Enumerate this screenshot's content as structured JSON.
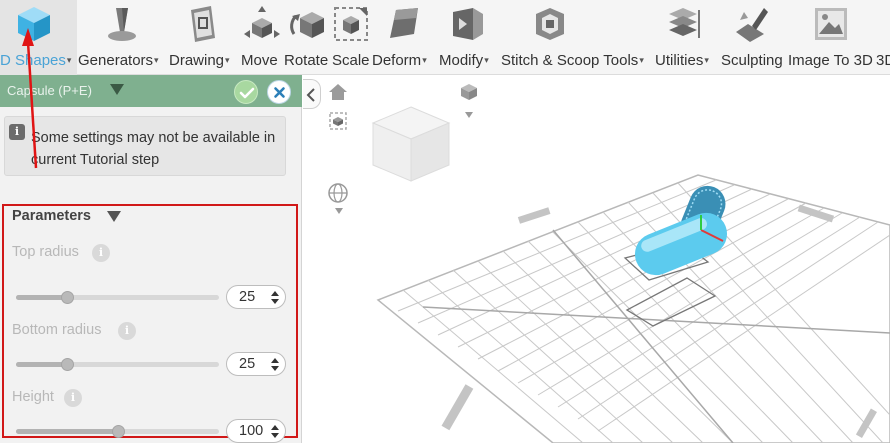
{
  "colors": {
    "accent": "#4aa3d6",
    "panel_header": "#7fb08f",
    "highlight_frame": "#d11818",
    "capsule": "#5ccbee"
  },
  "toolbar": {
    "items": [
      {
        "label": "D Shapes",
        "icon": "cube-icon"
      },
      {
        "label": "Generators",
        "icon": "generator-icon"
      },
      {
        "label": "Drawing",
        "icon": "drawing-icon"
      },
      {
        "label": "Move",
        "icon": "move-icon"
      },
      {
        "label": "Rotate",
        "icon": "rotate-icon"
      },
      {
        "label": "Scale",
        "icon": "scale-icon"
      },
      {
        "label": "Deform",
        "icon": "deform-icon"
      },
      {
        "label": "Modify",
        "icon": "modify-icon"
      },
      {
        "label": "Stitch & Scoop Tools",
        "icon": "stitch-icon"
      },
      {
        "label": "Utilities",
        "icon": "utilities-icon"
      },
      {
        "label": "Sculpting",
        "icon": "sculpting-icon"
      },
      {
        "label": "Image To 3D",
        "icon": "image-icon"
      },
      {
        "label": "3D",
        "icon": ""
      }
    ]
  },
  "panel": {
    "title": "Capsule (P+E)",
    "info_text": "Some settings may not be available in current Tutorial step",
    "section_title": "Parameters",
    "fields": [
      {
        "label": "Top radius",
        "value": "25",
        "slider_fraction": 0.25
      },
      {
        "label": "Bottom radius",
        "value": "25",
        "slider_fraction": 0.25
      },
      {
        "label": "Height",
        "value": "100",
        "slider_fraction": 0.5
      }
    ]
  }
}
